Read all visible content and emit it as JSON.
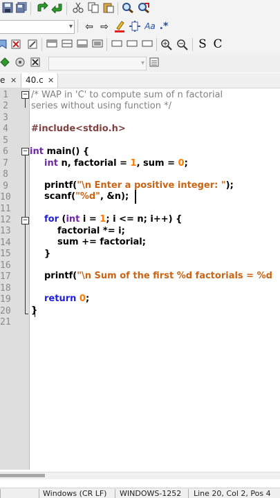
{
  "toolbar1": {
    "icons": [
      "save-icon",
      "save-all-icon",
      "redo-icon",
      "undo-icon",
      "cut-icon",
      "copy-icon",
      "paste-icon",
      "print-icon",
      "find-icon",
      "replace-icon"
    ]
  },
  "toolbar2": {
    "combo_value": "",
    "icons": [
      "back-icon",
      "forward-icon",
      "highlight-icon",
      "function-icon",
      "match-case-icon",
      "regex-icon"
    ],
    "match_case_label": "Aa",
    "regex_label": ".*"
  },
  "toolbar3": {
    "icons": [
      "bookmark-icon",
      "clear-icon",
      "layout-1-icon",
      "layout-2-icon",
      "layout-3-icon",
      "layout-4-icon",
      "box-1-icon",
      "box-2-icon",
      "box-3-icon",
      "zoom-in-icon",
      "zoom-out-icon",
      "letter-s-icon",
      "letter-c-icon"
    ],
    "s_label": "S",
    "c_label": "C"
  },
  "tabs": [
    {
      "label": "e",
      "active": false
    },
    {
      "label": "40.c",
      "active": true
    }
  ],
  "tab_close_glyph": "✕",
  "editor": {
    "line_numbers": [
      "1",
      "2",
      "3",
      "4",
      "5",
      "6",
      "7",
      "8",
      "9",
      "10",
      "11",
      "12",
      "13",
      "14",
      "15",
      "16",
      "17",
      "18",
      "19",
      "20",
      "21"
    ],
    "comment_line1": "/* WAP in 'C' to compute sum of n factorial",
    "comment_line2": "series without using function */",
    "include": "#include<stdio.h>",
    "main_type": "int",
    "main_rest": " main() {",
    "decl_type": "int",
    "decl_rest1": " n, factorial = ",
    "decl_num1": "1",
    "decl_rest2": ", sum = ",
    "decl_num2": "0",
    "decl_end": ";",
    "printf1_fn": "printf(",
    "printf1_str": "\"\\n Enter a positive integer: \"",
    "printf1_end": ");",
    "scanf_fn": "scanf(",
    "scanf_str": "\"%d\"",
    "scanf_rest": ", &n);",
    "for_kw": "for",
    "for_open": " (",
    "for_int": "int",
    "for_rest1": " i = ",
    "for_num1": "1",
    "for_rest2": "; i <= n; i++) {",
    "body1": "factorial *= i;",
    "body2": "sum += factorial;",
    "close_brace": "}",
    "printf2_fn": "printf(",
    "printf2_str": "\"\\n Sum of the first %d factorials = %d",
    "return_kw": "return",
    "return_num": "0",
    "return_end": ";",
    "main_close": "}"
  },
  "status": {
    "line_ending": "Windows (CR LF)",
    "encoding": "WINDOWS-1252",
    "position": "Line 20, Col 2, Pos 4"
  },
  "colors": {
    "keyword": "#2020d8",
    "type": "#6d28a8",
    "string": "#c86414",
    "number": "#ff7a00",
    "comment": "#808080"
  }
}
